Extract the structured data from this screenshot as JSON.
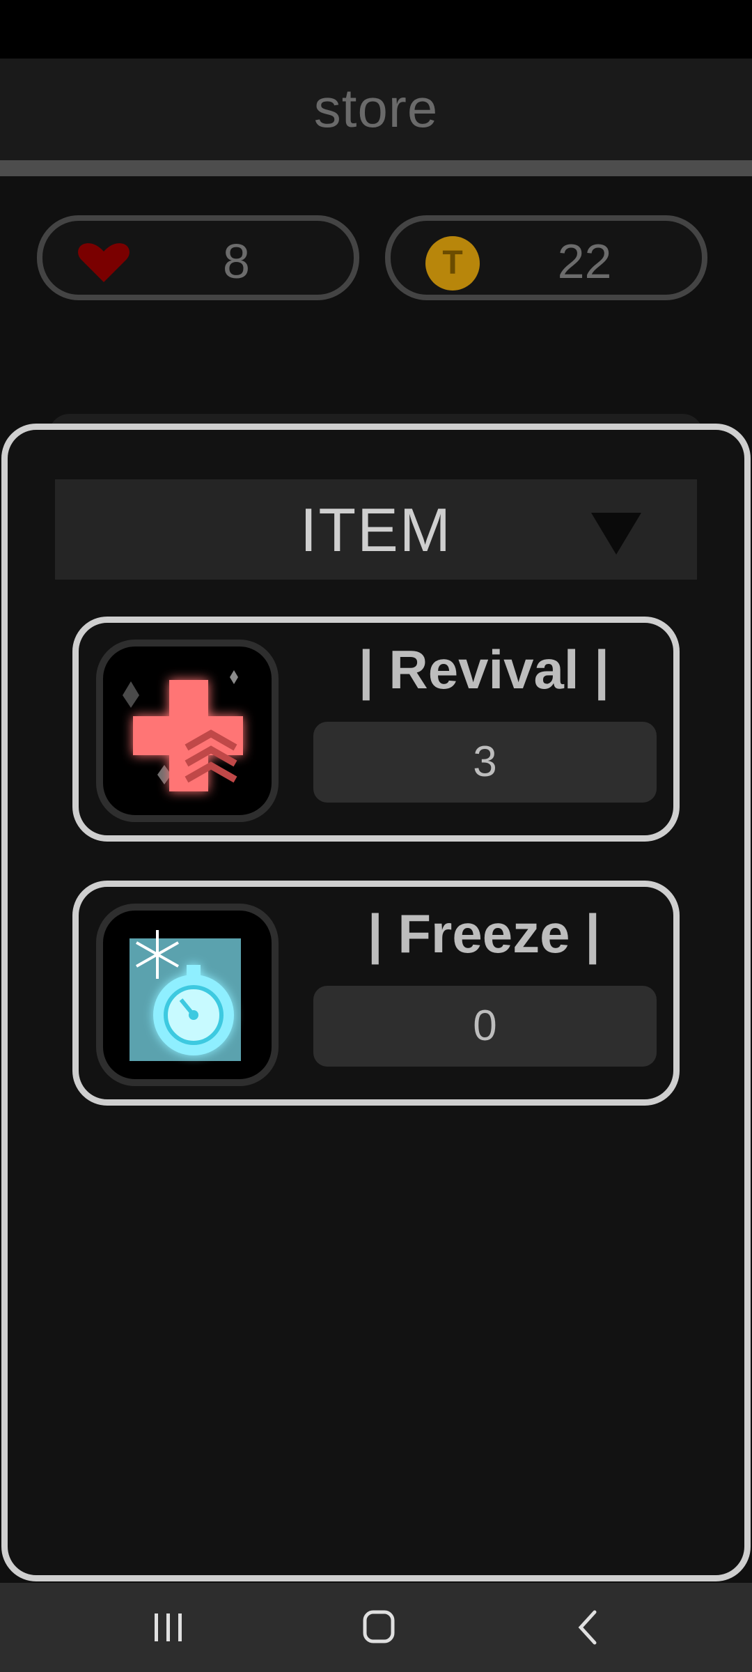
{
  "header": {
    "title": "store"
  },
  "resources": {
    "lives": {
      "icon": "heart-icon",
      "value": "8",
      "color": "#7a0000"
    },
    "coins": {
      "icon": "coin-icon",
      "symbol": "T",
      "value": "22",
      "color": "#b8860b"
    }
  },
  "category": {
    "selected": "ITEM"
  },
  "items": [
    {
      "name": "| Revival |",
      "count": "3",
      "icon": "revival-cross-icon",
      "color": "#ff6b6b"
    },
    {
      "name": "| Freeze |",
      "count": "0",
      "icon": "freeze-stopwatch-icon",
      "color": "#7ee8f5"
    }
  ],
  "nav": {
    "recent": "recent-apps-icon",
    "home": "home-icon",
    "back": "back-icon"
  }
}
